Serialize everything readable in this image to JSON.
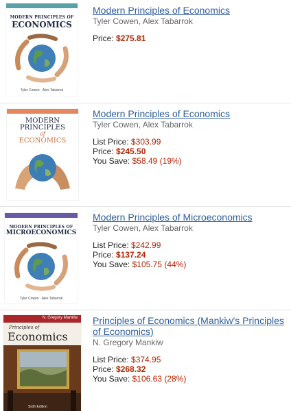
{
  "results": [
    {
      "title": "Modern Principles of Economics",
      "author": "Tyler Cowen, Alex Tabarrok",
      "price_label": "Price:",
      "price": "$275.81",
      "cover": {
        "line1": "MODERN PRINCIPLES OF",
        "line2": "ECONOMICS",
        "authors": "Tyler Cowen · Alex Tabarrok",
        "band_color": "#5aa1a6"
      }
    },
    {
      "title": "Modern Principles of Economics",
      "author": "Tyler Cowen, Alex Tabarrok",
      "list_price_label": "List Price:",
      "list_price": "$303.99",
      "price_label": "Price:",
      "price": "$245.50",
      "save_label": "You Save:",
      "save": "$58.49 (19%)",
      "cover": {
        "line1": "MODERN",
        "line2": "PRINCIPLES",
        "line3": "of",
        "line4": "ECONOMICS",
        "authors": "Tyler Cowen · Alex Tabarrok",
        "band_color": "#e4875d"
      }
    },
    {
      "title": "Modern Principles of Microeconomics",
      "author": "Tyler Cowen, Alex Tabarrok",
      "list_price_label": "List Price:",
      "list_price": "$242.99",
      "price_label": "Price:",
      "price": "$137.24",
      "save_label": "You Save:",
      "save": "$105.75 (44%)",
      "cover": {
        "line1": "MODERN PRINCIPLES OF",
        "line2": "MICROECONOMICS",
        "authors": "Tyler Cowen · Alex Tabarrok",
        "band_color": "#6a5aa6"
      }
    },
    {
      "title": "Principles of Economics (Mankiw's Principles of Economics)",
      "author": "N. Gregory Mankiw",
      "list_price_label": "List Price:",
      "list_price": "$374.95",
      "price_label": "Price:",
      "price": "$268.32",
      "save_label": "You Save:",
      "save": "$106.63 (28%)",
      "cover": {
        "author_top": "N. Gregory Mankiw",
        "line1": "Principles of",
        "line2": "Economics",
        "edition": "Sixth Edition",
        "band_color": "#a9262a"
      }
    }
  ],
  "colors": {
    "link": "#2e5e9a",
    "price": "#b12704",
    "author": "#666666"
  }
}
